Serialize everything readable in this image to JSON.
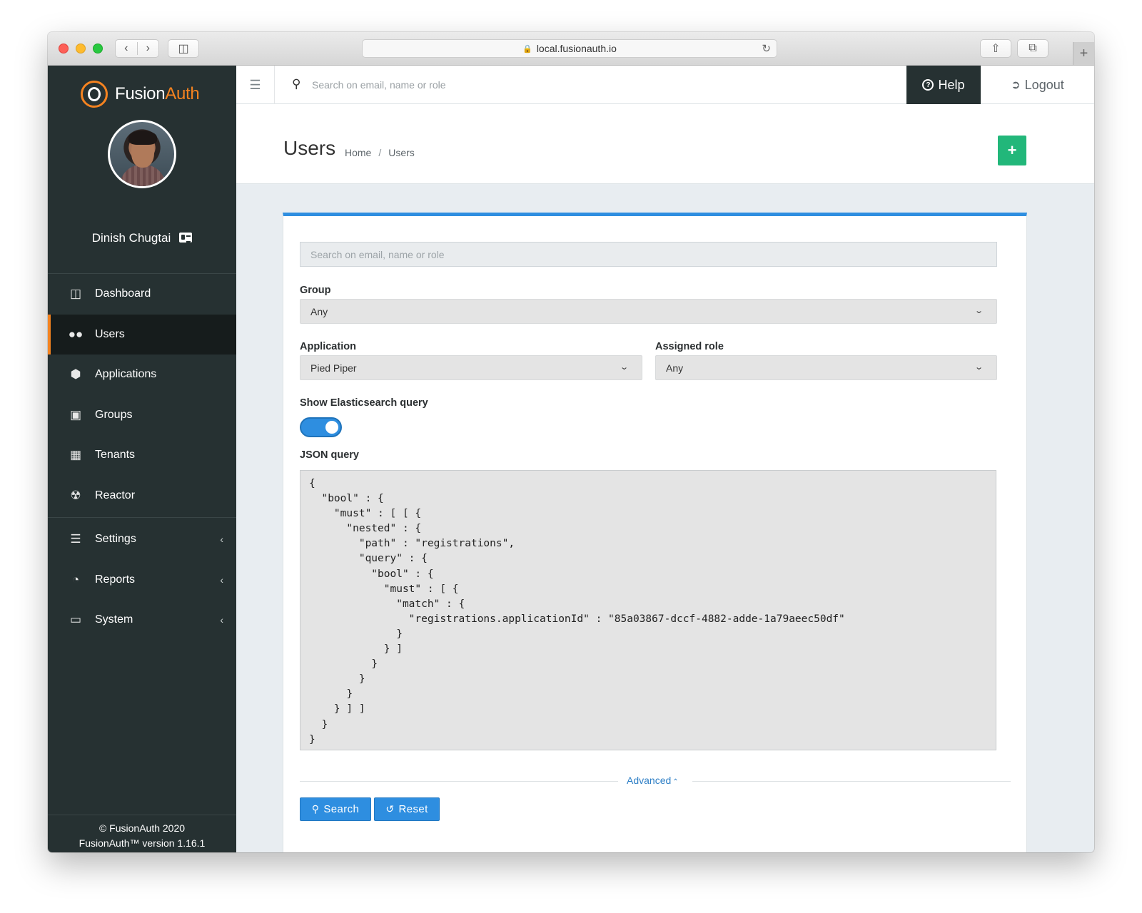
{
  "browser": {
    "url": "local.fusionauth.io"
  },
  "brand": {
    "name_part1": "Fusion",
    "name_part2": "Auth",
    "accent_color": "#f58320"
  },
  "user": {
    "name": "Dinish Chugtai"
  },
  "sidebar": {
    "items": [
      {
        "label": "Dashboard",
        "icon": "dashboard-icon"
      },
      {
        "label": "Users",
        "icon": "users-icon",
        "active": true
      },
      {
        "label": "Applications",
        "icon": "cube-icon"
      },
      {
        "label": "Groups",
        "icon": "groups-icon"
      },
      {
        "label": "Tenants",
        "icon": "building-icon"
      },
      {
        "label": "Reactor",
        "icon": "reactor-icon"
      },
      {
        "label": "Settings",
        "icon": "sliders-icon",
        "expandable": true
      },
      {
        "label": "Reports",
        "icon": "pie-chart-icon",
        "expandable": true
      },
      {
        "label": "System",
        "icon": "desktop-icon",
        "expandable": true
      }
    ],
    "footer_line1": "© FusionAuth 2020",
    "footer_line2": "FusionAuth™ version 1.16.1"
  },
  "topbar": {
    "search_placeholder": "Search on email, name or role",
    "help_label": "Help",
    "logout_label": "Logout"
  },
  "page": {
    "title": "Users",
    "breadcrumb": [
      "Home",
      "Users"
    ]
  },
  "form": {
    "search_placeholder": "Search on email, name or role",
    "group_label": "Group",
    "group_value": "Any",
    "application_label": "Application",
    "application_value": "Pied Piper",
    "role_label": "Assigned role",
    "role_value": "Any",
    "show_query_label": "Show Elasticsearch query",
    "show_query_enabled": true,
    "json_label": "JSON query",
    "json_query": "{\n  \"bool\" : {\n    \"must\" : [ [ {\n      \"nested\" : {\n        \"path\" : \"registrations\",\n        \"query\" : {\n          \"bool\" : {\n            \"must\" : [ {\n              \"match\" : {\n                \"registrations.applicationId\" : \"85a03867-dccf-4882-adde-1a79aeec50df\"\n              }\n            } ]\n          }\n        }\n      }\n    } ] ]\n  }\n}",
    "advanced_label": "Advanced",
    "search_button": "Search",
    "reset_button": "Reset",
    "primary_color": "#2e8ee0",
    "add_button_color": "#22b77a"
  }
}
